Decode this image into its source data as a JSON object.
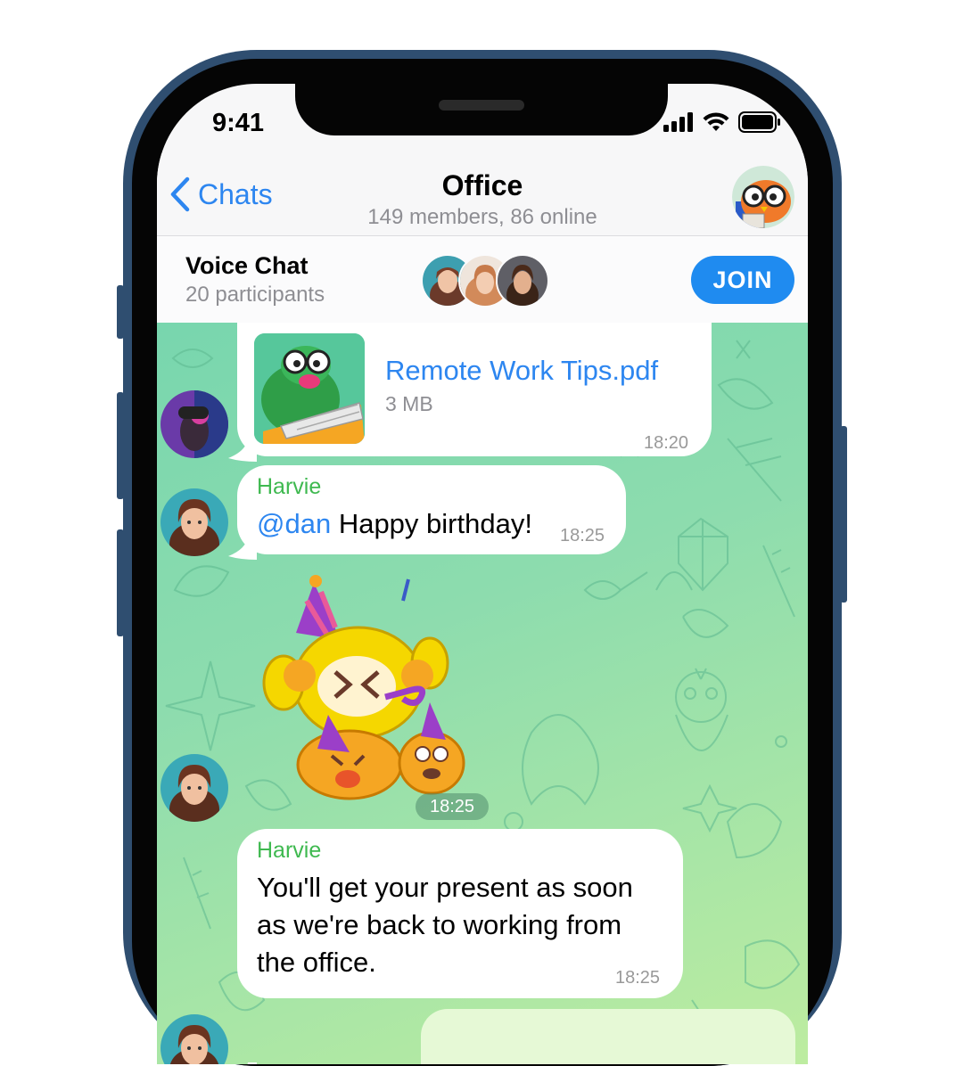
{
  "status_bar": {
    "time": "9:41"
  },
  "nav": {
    "back_label": "Chats",
    "title": "Office",
    "subtitle": "149 members, 86 online"
  },
  "voice_chat": {
    "title": "Voice Chat",
    "participants": "20 participants",
    "join_label": "JOIN"
  },
  "messages": [
    {
      "type": "file",
      "file_name": "Remote Work Tips.pdf",
      "file_size": "3 MB",
      "time": "18:20"
    },
    {
      "type": "text",
      "sender": "Harvie",
      "mention": "@dan",
      "text": " Happy birthday!",
      "time": "18:25"
    },
    {
      "type": "sticker",
      "time": "18:25"
    },
    {
      "type": "text",
      "sender": "Harvie",
      "lines": [
        "You'll get your present as soon",
        "as we're back to working from",
        "the office."
      ],
      "time": "18:25"
    }
  ],
  "colors": {
    "accent": "#2d86f0",
    "sender_name": "#3fb950",
    "join_button": "#1f8bf0",
    "frame": "#2f4e70",
    "chat_bg_start": "#78d6ae",
    "chat_bg_end": "#bdeca0"
  }
}
